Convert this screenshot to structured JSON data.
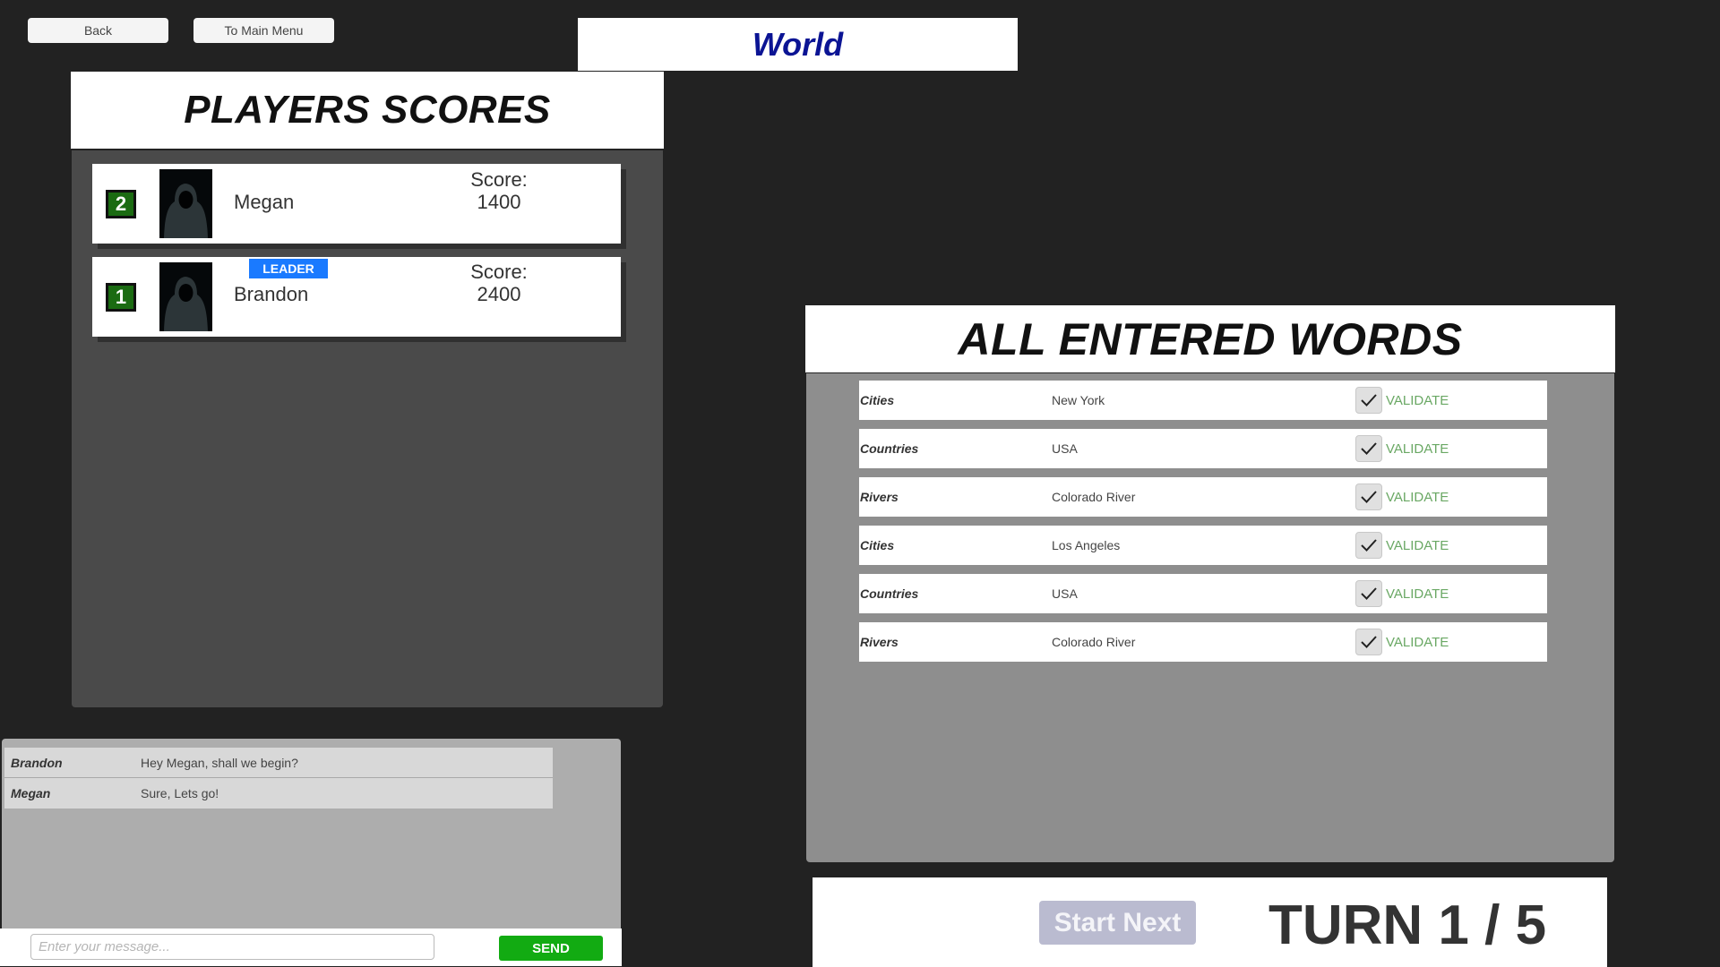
{
  "nav": {
    "back_label": "Back",
    "main_menu_label": "To Main Menu"
  },
  "category": {
    "title": "World",
    "color": "#0b1494"
  },
  "scores": {
    "title": "PLAYERS SCORES",
    "score_label": "Score:",
    "players": [
      {
        "rank": "2",
        "name": "Megan",
        "score": "1400",
        "leader": false
      },
      {
        "rank": "1",
        "name": "Brandon",
        "score": "2400",
        "leader": true,
        "badge": "LEADER"
      }
    ]
  },
  "chat": {
    "messages": [
      {
        "sender": "Brandon",
        "text": "Hey Megan, shall we begin?"
      },
      {
        "sender": "Megan",
        "text": "Sure, Lets go!"
      }
    ],
    "input_placeholder": "Enter your message...",
    "input_value": "",
    "send_label": "SEND"
  },
  "words": {
    "title": "ALL ENTERED WORDS",
    "validate_label": "VALIDATE",
    "entries": [
      {
        "category": "Cities",
        "word": "New York",
        "validated": true
      },
      {
        "category": "Countries",
        "word": "USA",
        "validated": true
      },
      {
        "category": "Rivers",
        "word": "Colorado River",
        "validated": true
      },
      {
        "category": "Cities",
        "word": "Los Angeles",
        "validated": true
      },
      {
        "category": "Countries",
        "word": "USA",
        "validated": true
      },
      {
        "category": "Rivers",
        "word": "Colorado River",
        "validated": true
      }
    ]
  },
  "turn": {
    "start_next_label": "Start Next",
    "label": "TURN 1 / 5",
    "current": 1,
    "total": 5
  },
  "colors": {
    "leader_badge": "#1a7aff",
    "rank_badge": "#1b6b12",
    "send_button": "#12ab12",
    "validate_text": "#6aa864",
    "start_next_disabled": "#babbd0"
  }
}
